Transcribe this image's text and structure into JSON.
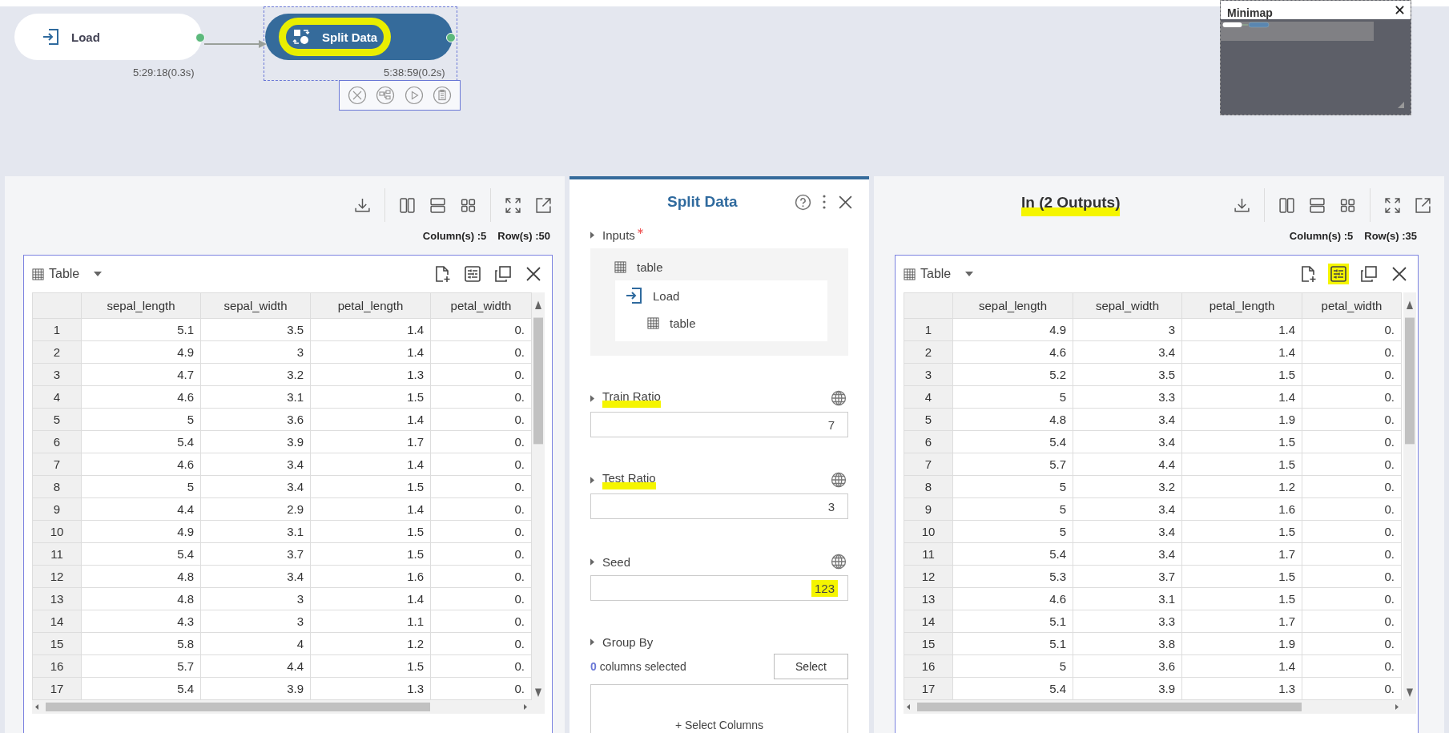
{
  "canvas": {
    "nodes": [
      {
        "label": "Load",
        "kind": "load",
        "selected": false,
        "highlighted": false,
        "time": "5:29:18(0.3s)"
      },
      {
        "label": "Split Data",
        "kind": "split",
        "selected": true,
        "highlighted": true,
        "time": "5:38:59(0.2s)"
      }
    ],
    "minimap": {
      "title": "Minimap"
    }
  },
  "panels": [
    {
      "stats": {
        "columns": "Column(s) :5",
        "rows": "Row(s) :50"
      },
      "table": {
        "view": "Table",
        "tools": [
          {
            "kind": "add-file",
            "highlighted": false
          },
          {
            "kind": "settings-list",
            "highlighted": false
          },
          {
            "kind": "copy",
            "highlighted": false
          },
          {
            "kind": "close",
            "highlighted": false
          }
        ],
        "columns": [
          "sepal_length",
          "sepal_width",
          "petal_length",
          "petal_width"
        ],
        "rows": [
          {
            "index": "1",
            "cells": [
              "5.1",
              "3.5",
              "1.4",
              "0."
            ]
          },
          {
            "index": "2",
            "cells": [
              "4.9",
              "3",
              "1.4",
              "0."
            ]
          },
          {
            "index": "3",
            "cells": [
              "4.7",
              "3.2",
              "1.3",
              "0."
            ]
          },
          {
            "index": "4",
            "cells": [
              "4.6",
              "3.1",
              "1.5",
              "0."
            ]
          },
          {
            "index": "5",
            "cells": [
              "5",
              "3.6",
              "1.4",
              "0."
            ]
          },
          {
            "index": "6",
            "cells": [
              "5.4",
              "3.9",
              "1.7",
              "0."
            ]
          },
          {
            "index": "7",
            "cells": [
              "4.6",
              "3.4",
              "1.4",
              "0."
            ]
          },
          {
            "index": "8",
            "cells": [
              "5",
              "3.4",
              "1.5",
              "0."
            ]
          },
          {
            "index": "9",
            "cells": [
              "4.4",
              "2.9",
              "1.4",
              "0."
            ]
          },
          {
            "index": "10",
            "cells": [
              "4.9",
              "3.1",
              "1.5",
              "0."
            ]
          },
          {
            "index": "11",
            "cells": [
              "5.4",
              "3.7",
              "1.5",
              "0."
            ]
          },
          {
            "index": "12",
            "cells": [
              "4.8",
              "3.4",
              "1.6",
              "0."
            ]
          },
          {
            "index": "13",
            "cells": [
              "4.8",
              "3",
              "1.4",
              "0."
            ]
          },
          {
            "index": "14",
            "cells": [
              "4.3",
              "3",
              "1.1",
              "0."
            ]
          },
          {
            "index": "15",
            "cells": [
              "5.8",
              "4",
              "1.2",
              "0."
            ]
          },
          {
            "index": "16",
            "cells": [
              "5.7",
              "4.4",
              "1.5",
              "0."
            ]
          },
          {
            "index": "17",
            "cells": [
              "5.4",
              "3.9",
              "1.3",
              "0."
            ]
          }
        ]
      }
    },
    {
      "title": "In (2 Outputs)",
      "title_highlighted": true,
      "stats": {
        "columns": "Column(s) :5",
        "rows": "Row(s) :35"
      },
      "table": {
        "view": "Table",
        "tools": [
          {
            "kind": "add-file",
            "highlighted": false
          },
          {
            "kind": "settings-list",
            "highlighted": true
          },
          {
            "kind": "copy",
            "highlighted": false
          },
          {
            "kind": "close",
            "highlighted": false
          }
        ],
        "columns": [
          "sepal_length",
          "sepal_width",
          "petal_length",
          "petal_width"
        ],
        "rows": [
          {
            "index": "1",
            "cells": [
              "4.9",
              "3",
              "1.4",
              "0."
            ]
          },
          {
            "index": "2",
            "cells": [
              "4.6",
              "3.4",
              "1.4",
              "0."
            ]
          },
          {
            "index": "3",
            "cells": [
              "5.2",
              "3.5",
              "1.5",
              "0."
            ]
          },
          {
            "index": "4",
            "cells": [
              "5",
              "3.3",
              "1.4",
              "0."
            ]
          },
          {
            "index": "5",
            "cells": [
              "4.8",
              "3.4",
              "1.9",
              "0."
            ]
          },
          {
            "index": "6",
            "cells": [
              "5.4",
              "3.4",
              "1.5",
              "0."
            ]
          },
          {
            "index": "7",
            "cells": [
              "5.7",
              "4.4",
              "1.5",
              "0."
            ]
          },
          {
            "index": "8",
            "cells": [
              "5",
              "3.2",
              "1.2",
              "0."
            ]
          },
          {
            "index": "9",
            "cells": [
              "5",
              "3.4",
              "1.6",
              "0."
            ]
          },
          {
            "index": "10",
            "cells": [
              "5",
              "3.4",
              "1.5",
              "0."
            ]
          },
          {
            "index": "11",
            "cells": [
              "5.4",
              "3.4",
              "1.7",
              "0."
            ]
          },
          {
            "index": "12",
            "cells": [
              "5.3",
              "3.7",
              "1.5",
              "0."
            ]
          },
          {
            "index": "13",
            "cells": [
              "4.6",
              "3.1",
              "1.5",
              "0."
            ]
          },
          {
            "index": "14",
            "cells": [
              "5.1",
              "3.3",
              "1.7",
              "0."
            ]
          },
          {
            "index": "15",
            "cells": [
              "5.1",
              "3.8",
              "1.9",
              "0."
            ]
          },
          {
            "index": "16",
            "cells": [
              "5",
              "3.6",
              "1.4",
              "0."
            ]
          },
          {
            "index": "17",
            "cells": [
              "5.4",
              "3.9",
              "1.3",
              "0."
            ]
          }
        ]
      }
    }
  ],
  "settings": {
    "title": "Split Data",
    "inputs": {
      "label": "Inputs",
      "required": true,
      "port": "table",
      "source": {
        "label": "Load",
        "port": "table"
      }
    },
    "params": [
      {
        "label": "Train Ratio",
        "value": "7",
        "label_highlighted": true,
        "value_highlighted": false
      },
      {
        "label": "Test Ratio",
        "value": "3",
        "label_highlighted": true,
        "value_highlighted": false
      },
      {
        "label": "Seed",
        "value": "123",
        "label_highlighted": false,
        "value_highlighted": true
      }
    ],
    "group_by": {
      "label": "Group By",
      "count": "0",
      "count_text": "columns selected",
      "button": "Select",
      "action": "+ Select Columns"
    }
  }
}
